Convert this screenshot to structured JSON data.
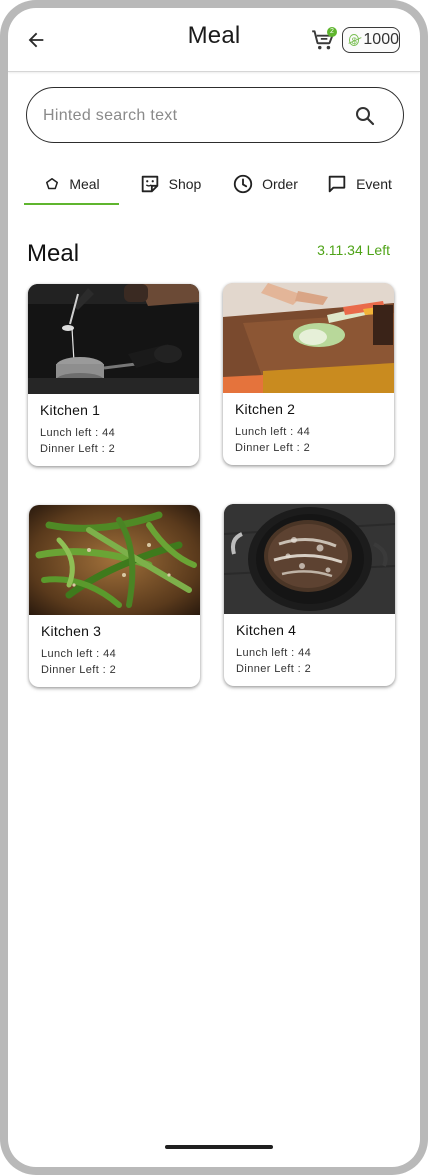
{
  "header": {
    "title": "Meal",
    "cart_badge": "2",
    "coin_symbol": "$",
    "coins": "1000",
    "back_icon": "arrow-left-icon",
    "cart_icon": "cart-icon"
  },
  "search": {
    "placeholder": "Hinted search text",
    "icon": "search-icon"
  },
  "tabs": [
    {
      "label": "Meal",
      "icon": "pentagon-icon",
      "active": true
    },
    {
      "label": "Shop",
      "icon": "sticker-icon",
      "active": false
    },
    {
      "label": "Order",
      "icon": "clock-icon",
      "active": false
    },
    {
      "label": "Event",
      "icon": "chat-bubble-icon",
      "active": false
    }
  ],
  "section": {
    "title": "Meal",
    "left_text": "3.11.34 Left"
  },
  "kitchens": [
    {
      "name": "Kitchen 1",
      "lunch": "Lunch left : 44",
      "dinner": "Dinner Left : 2"
    },
    {
      "name": "Kitchen 2",
      "lunch": "Lunch left : 44",
      "dinner": "Dinner Left : 2"
    },
    {
      "name": "Kitchen 3",
      "lunch": "Lunch left : 44",
      "dinner": "Dinner Left : 2"
    },
    {
      "name": "Kitchen 4",
      "lunch": "Lunch left : 44",
      "dinner": "Dinner Left : 2"
    }
  ],
  "colors": {
    "accent": "#5fb52e",
    "frame": "#b9b9b9"
  }
}
